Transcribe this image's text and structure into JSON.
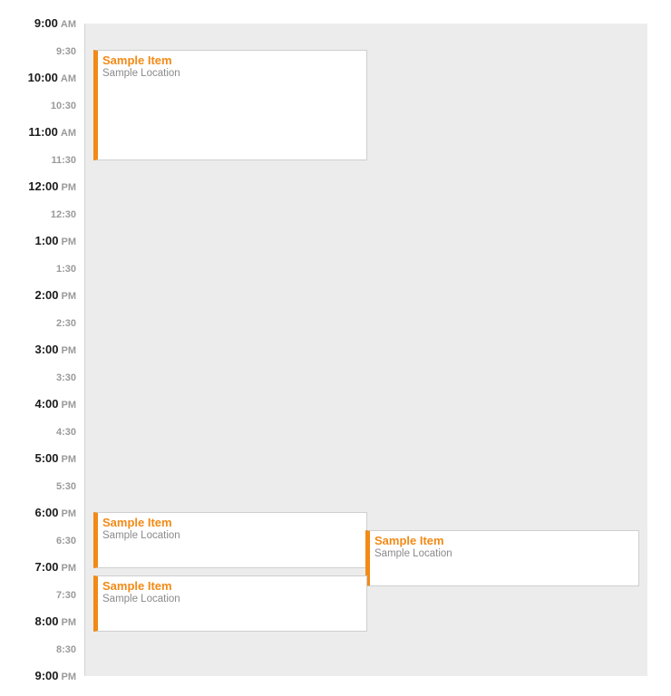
{
  "colors": {
    "accent": "#f28a16",
    "grid_background": "#ececec",
    "event_background": "#ffffff",
    "event_border": "#cfcfcf",
    "major_time_text": "#1b1b1b",
    "minor_time_text": "#9a9a9a"
  },
  "time_labels": [
    {
      "time": "9:00",
      "ampm": "AM"
    },
    {
      "time": "9:30",
      "ampm": ""
    },
    {
      "time": "10:00",
      "ampm": "AM"
    },
    {
      "time": "10:30",
      "ampm": ""
    },
    {
      "time": "11:00",
      "ampm": "AM"
    },
    {
      "time": "11:30",
      "ampm": ""
    },
    {
      "time": "12:00",
      "ampm": "PM"
    },
    {
      "time": "12:30",
      "ampm": ""
    },
    {
      "time": "1:00",
      "ampm": "PM"
    },
    {
      "time": "1:30",
      "ampm": ""
    },
    {
      "time": "2:00",
      "ampm": "PM"
    },
    {
      "time": "2:30",
      "ampm": ""
    },
    {
      "time": "3:00",
      "ampm": "PM"
    },
    {
      "time": "3:30",
      "ampm": ""
    },
    {
      "time": "4:00",
      "ampm": "PM"
    },
    {
      "time": "4:30",
      "ampm": ""
    },
    {
      "time": "5:00",
      "ampm": "PM"
    },
    {
      "time": "5:30",
      "ampm": ""
    },
    {
      "time": "6:00",
      "ampm": "PM"
    },
    {
      "time": "6:30",
      "ampm": ""
    },
    {
      "time": "7:00",
      "ampm": "PM"
    },
    {
      "time": "7:30",
      "ampm": ""
    },
    {
      "time": "8:00",
      "ampm": "PM"
    },
    {
      "time": "8:30",
      "ampm": ""
    },
    {
      "time": "9:00",
      "ampm": "PM"
    }
  ],
  "events": [
    {
      "title": "Sample Item",
      "location": "Sample Location"
    },
    {
      "title": "Sample Item",
      "location": "Sample Location"
    },
    {
      "title": "Sample Item",
      "location": "Sample Location"
    },
    {
      "title": "Sample Item",
      "location": "Sample Location"
    }
  ]
}
